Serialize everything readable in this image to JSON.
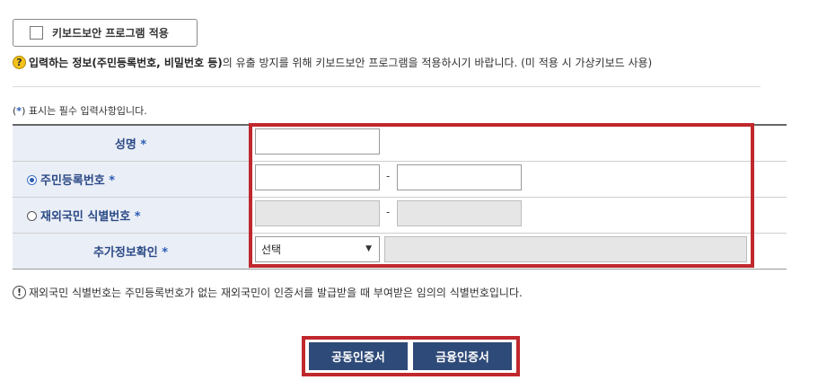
{
  "keyboard_security": {
    "label": "키보드보안 프로그램 적용",
    "checked": false
  },
  "notice": {
    "icon": "question-icon",
    "bold_text": "입력하는 정보(주민등록번호, 비밀번호 등)",
    "rest_text": "의 유출 방지를 위해 키보드보안 프로그램을 적용하시기 바랍니다. (미 적용 시 가상키보드 사용)"
  },
  "required_note": {
    "prefix": "(",
    "star": "*",
    "suffix": ") 표시는 필수 입력사항입니다."
  },
  "form": {
    "name_label": "성명",
    "resident_label": "주민등록번호",
    "foreigner_label": "재외국민 식별번호",
    "extra_label": "추가정보확인",
    "required_star": "*",
    "dash": "-",
    "select_value": "선택",
    "name_value": "",
    "resident_front": "",
    "resident_back": "",
    "foreigner_front": "",
    "foreigner_back": "",
    "extra_value": ""
  },
  "info": {
    "icon": "exclamation-icon",
    "text": "재외국민 식별번호는 주민등록번호가 없는 재외국민이 인증서를 발급받을 때 부여받은 임의의 식별번호입니다."
  },
  "buttons": {
    "joint_cert": "공동인증서",
    "financial_cert": "금융인증서"
  },
  "colors": {
    "accent": "#2e4a78",
    "highlight_border": "#c0282d",
    "label_bg": "#eaeef6",
    "label_text": "#2b4a86"
  }
}
